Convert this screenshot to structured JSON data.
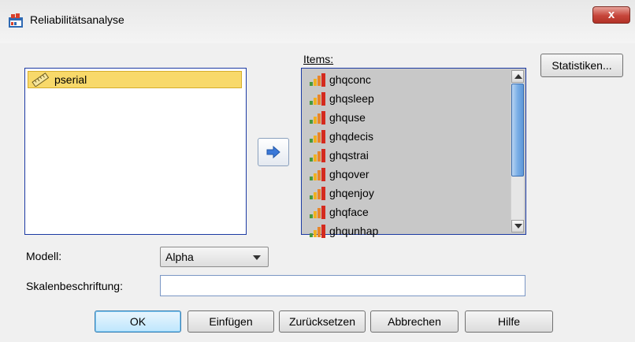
{
  "window": {
    "title": "Reliabilitätsanalyse",
    "close_label": "x"
  },
  "source_list": {
    "items": [
      {
        "label": "pserial",
        "icon": "ruler-icon",
        "selected": true
      }
    ]
  },
  "items_panel": {
    "label": "Items:",
    "items": [
      {
        "label": "ghqconc",
        "icon": "ordinal-bars-icon"
      },
      {
        "label": "ghqsleep",
        "icon": "ordinal-bars-icon"
      },
      {
        "label": "ghquse",
        "icon": "ordinal-bars-icon"
      },
      {
        "label": "ghqdecis",
        "icon": "ordinal-bars-icon"
      },
      {
        "label": "ghqstrai",
        "icon": "ordinal-bars-icon"
      },
      {
        "label": "ghqover",
        "icon": "ordinal-bars-icon"
      },
      {
        "label": "ghqenjoy",
        "icon": "ordinal-bars-icon"
      },
      {
        "label": "ghqface",
        "icon": "ordinal-bars-icon"
      },
      {
        "label": "ghqunhap",
        "icon": "ordinal-bars-icon"
      }
    ]
  },
  "buttons": {
    "statistiken": "Statistiken...",
    "ok": "OK",
    "einfuegen": "Einfügen",
    "zuruecksetzen": "Zurücksetzen",
    "abbrechen": "Abbrechen",
    "hilfe": "Hilfe"
  },
  "form": {
    "modell_label": "Modell:",
    "modell_value": "Alpha",
    "skalen_label": "Skalenbeschriftung:",
    "skalen_value": ""
  },
  "colors": {
    "selection": "#f8d96a",
    "list_border": "#1c3aa3",
    "items_bg": "#c8c8c8",
    "move_arrow": "#3a78d8"
  }
}
